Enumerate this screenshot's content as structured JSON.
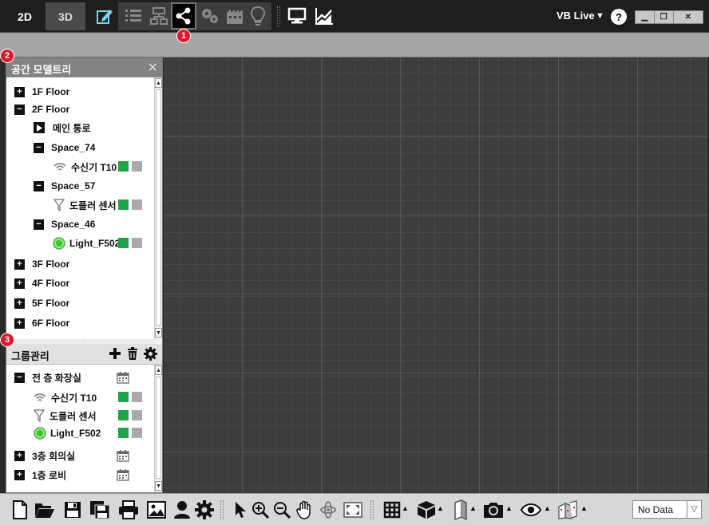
{
  "top_bar": {
    "tab_2d": "2D",
    "tab_3d": "3D",
    "mode_label": "VB Live",
    "help": "?",
    "badge_1": "1"
  },
  "space_tree": {
    "title": "공간 모델트리",
    "badge": "2",
    "items": [
      {
        "label": "1F Floor",
        "toggle": "+"
      },
      {
        "label": "2F Floor",
        "toggle": "−"
      },
      {
        "label": "메인 통로"
      },
      {
        "label": "Space_74",
        "toggle": "−"
      },
      {
        "label": "수신기 T10"
      },
      {
        "label": "Space_57",
        "toggle": "−"
      },
      {
        "label": "도플러 센서"
      },
      {
        "label": "Space_46",
        "toggle": "−"
      },
      {
        "label": "Light_F502"
      },
      {
        "label": "3F Floor",
        "toggle": "+"
      },
      {
        "label": "4F Floor",
        "toggle": "+"
      },
      {
        "label": "5F Floor",
        "toggle": "+"
      },
      {
        "label": "6F Floor",
        "toggle": "+"
      }
    ]
  },
  "group_panel": {
    "title": "그룹관리",
    "badge": "3",
    "items": [
      {
        "label": "전 층 화장실",
        "toggle": "−"
      },
      {
        "label": "수신기 T10"
      },
      {
        "label": "도플러 센서"
      },
      {
        "label": "Light_F502"
      },
      {
        "label": "3층 회의실",
        "toggle": "+"
      },
      {
        "label": "1층 로비",
        "toggle": "+"
      }
    ]
  },
  "bottom_bar": {
    "data_select": "No Data"
  },
  "colors": {
    "status_on": "#21a34a",
    "status_off": "#aaaaaa",
    "badge": "#e4162b"
  }
}
